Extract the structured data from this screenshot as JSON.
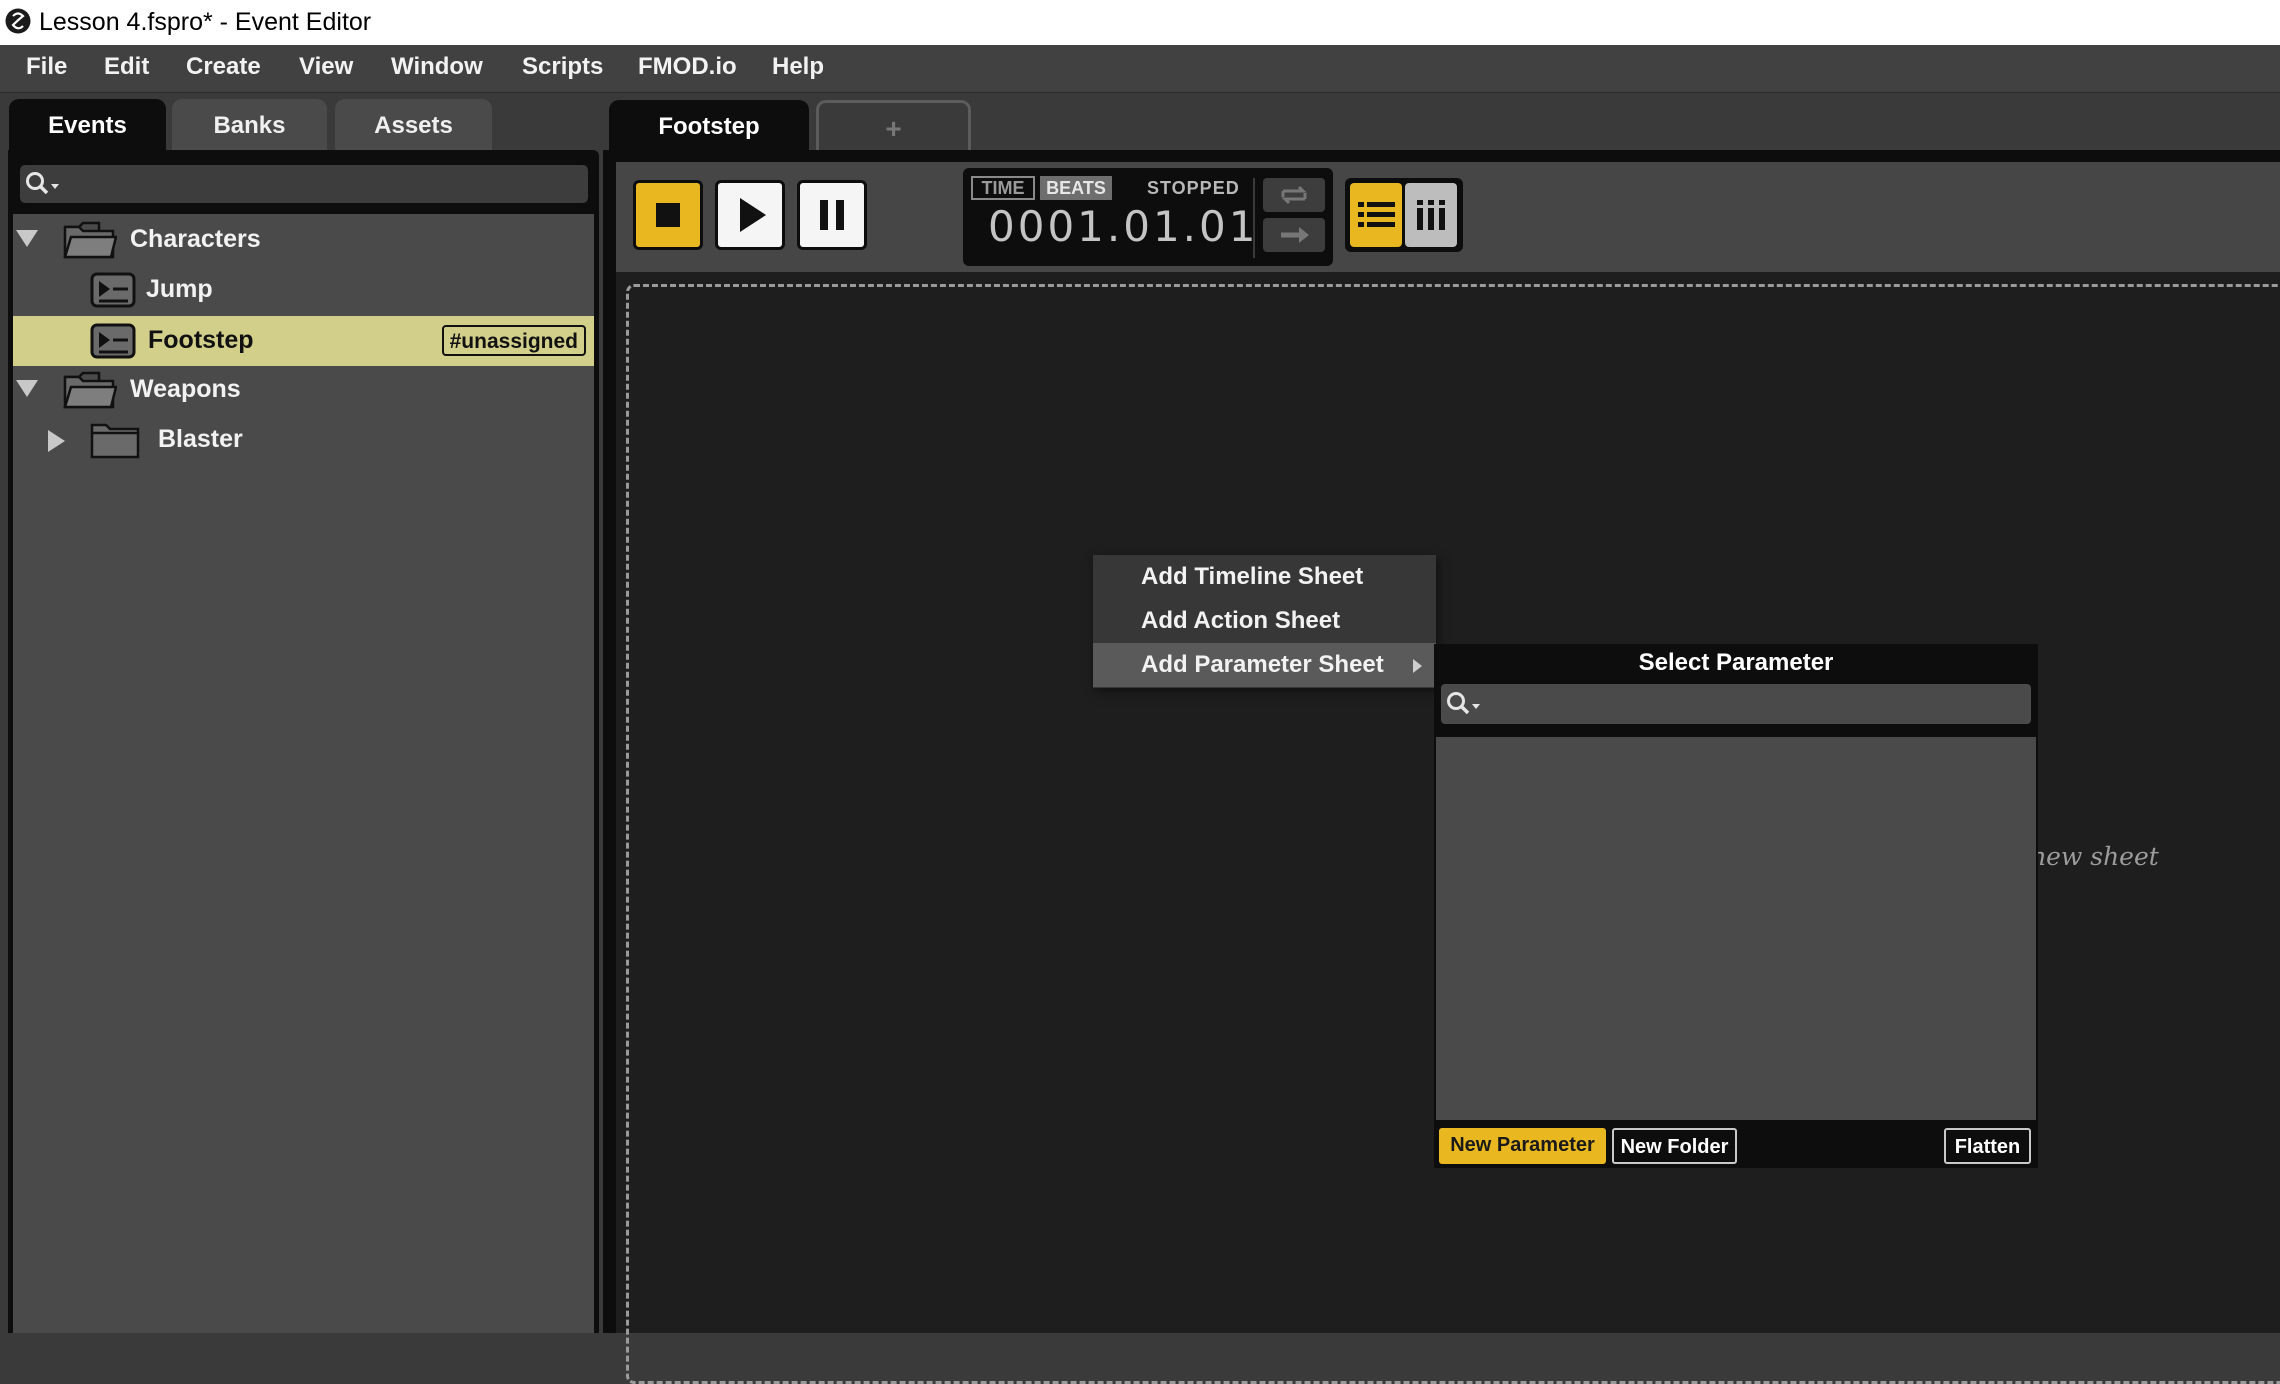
{
  "window": {
    "title": "Lesson 4.fspro* - Event Editor",
    "logo_icon": "fmod-logo-icon"
  },
  "menubar": {
    "items": [
      {
        "label": "File"
      },
      {
        "label": "Edit"
      },
      {
        "label": "Create"
      },
      {
        "label": "View"
      },
      {
        "label": "Window"
      },
      {
        "label": "Scripts"
      },
      {
        "label": "FMOD.io"
      },
      {
        "label": "Help"
      }
    ]
  },
  "browser": {
    "tabs": [
      {
        "label": "Events",
        "active": true
      },
      {
        "label": "Banks",
        "active": false
      },
      {
        "label": "Assets",
        "active": false
      }
    ],
    "search": {
      "value": "",
      "icon": "search-icon"
    },
    "tree": [
      {
        "label": "Characters",
        "type": "folder",
        "expanded": true
      },
      {
        "label": "Jump",
        "type": "event"
      },
      {
        "label": "Footstep",
        "type": "event",
        "selected": true,
        "badge": "#unassigned"
      },
      {
        "label": "Weapons",
        "type": "folder",
        "expanded": true
      },
      {
        "label": "Blaster",
        "type": "folder",
        "expanded": false
      }
    ]
  },
  "editor": {
    "tabs": [
      {
        "label": "Footstep",
        "active": true
      },
      {
        "label": "+",
        "active": false
      }
    ],
    "transport": {
      "time_mode_label": "TIME",
      "beats_mode_label": "BEATS",
      "active_mode": "BEATS",
      "status": "STOPPED",
      "time_value": "0001.01.01"
    },
    "hint_text": "new sheet",
    "colors": {
      "accent": "#e9b820",
      "selected_row": "#d2cf8b",
      "panel": "#0d0d0d",
      "list_bg": "#4a4a4a"
    }
  },
  "context_menu": {
    "items": [
      {
        "label": "Add Timeline Sheet"
      },
      {
        "label": "Add Action Sheet"
      },
      {
        "label": "Add Parameter Sheet",
        "has_submenu": true,
        "active": true
      }
    ]
  },
  "param_popup": {
    "title": "Select Parameter",
    "search_value": "",
    "buttons": {
      "new_parameter": "New Parameter",
      "new_folder": "New Folder",
      "flatten": "Flatten"
    }
  }
}
